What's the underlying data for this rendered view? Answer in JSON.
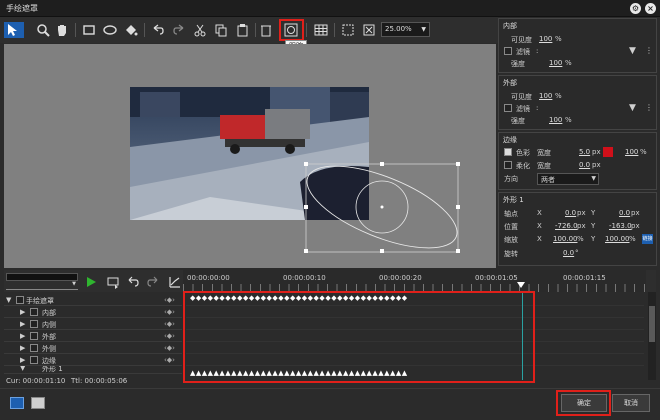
{
  "window": {
    "title": "手绘遮罩"
  },
  "toolbar": {
    "zoom_value": "25.00%",
    "tooltip": "跟踪"
  },
  "props": {
    "inner": {
      "title": "内部",
      "visibility_label": "可见度",
      "visibility_value": "100",
      "visibility_unit": "%",
      "filter_label": "滤镜",
      "filter_colon": ":",
      "strength_label": "强度",
      "strength_value": "100",
      "strength_unit": "%"
    },
    "outer": {
      "title": "外部",
      "visibility_label": "可见度",
      "visibility_value": "100",
      "visibility_unit": "%",
      "filter_label": "滤镜",
      "filter_colon": ":",
      "strength_label": "强度",
      "strength_value": "100",
      "strength_unit": "%"
    },
    "edge": {
      "title": "边缘",
      "color_label": "色彩",
      "width_label": "宽度",
      "width_value": "5.0",
      "width_unit": "px",
      "color_pct_value": "100",
      "color_pct_unit": "%",
      "soften_label": "柔化",
      "soften_width_label": "宽度",
      "soften_width_value": "0.0",
      "soften_width_unit": "px",
      "direction_label": "方向",
      "direction_value": "两者",
      "color": "#d0101a"
    },
    "shape": {
      "title": "外形 1",
      "axis_label": "轴点",
      "axis_x": "0.0",
      "axis_y": "0.0",
      "pos_label": "位置",
      "pos_x": "-726.0",
      "pos_y": "-163.0",
      "scale_label": "缩放",
      "scale_x": "100.00",
      "scale_y": "100.00",
      "scale_unit": "%",
      "rotate_label": "旋转",
      "rotate_value": "0.0",
      "rotate_unit": "°",
      "x_label": "X",
      "y_label": "Y",
      "px_unit": "px",
      "link_icon_label": "链接"
    }
  },
  "timeline": {
    "ruler_labels": [
      "00:00:00:00",
      "00:00:00:10",
      "00:00:00:20",
      "00:00:01:05",
      "00:00:01:15"
    ],
    "tracks": [
      "手绘遮罩",
      "内部",
      "内侧",
      "外部",
      "外侧",
      "边缘",
      "外形 1"
    ],
    "status_cur": "Cur: 00:00:01:10",
    "status_ttl": "Ttl: 00:00:05:06"
  },
  "footer": {
    "ok_label": "确定",
    "cancel_label": "取消"
  },
  "colors": {
    "accent_red": "#e0201a",
    "play_green": "#2fb52f"
  }
}
